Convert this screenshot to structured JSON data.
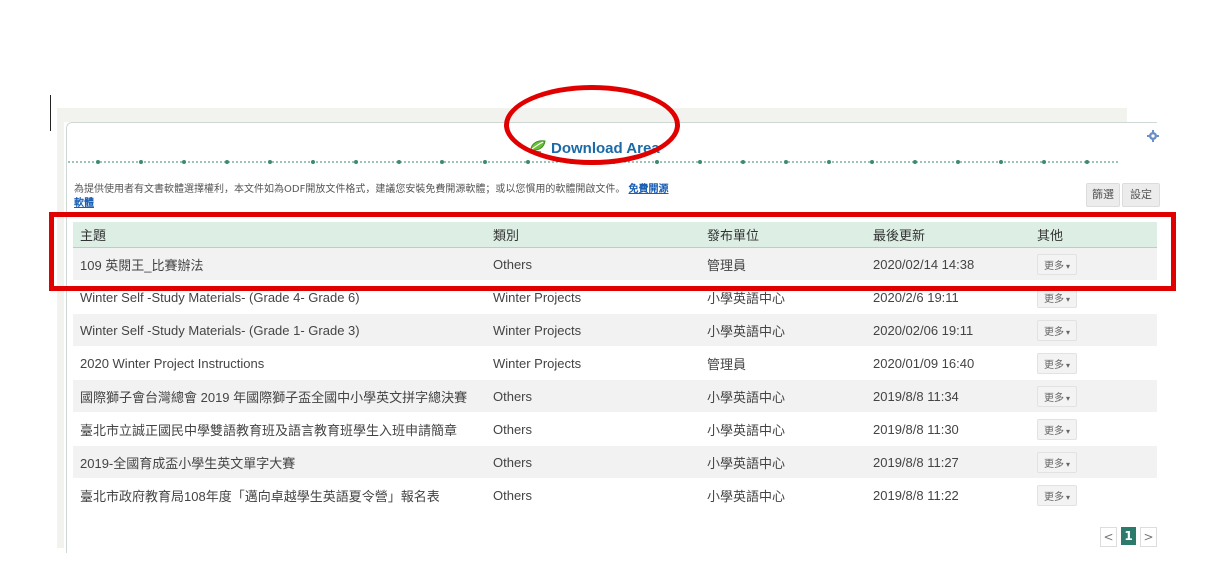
{
  "panel": {
    "title": "Download Area",
    "notice_text": "為提供使用者有文書軟體選擇權利，本文件如為ODF開放文件格式，建議您安裝免費開源軟體；或以您慣用的軟體開啟文件。",
    "notice_link": "免費開源軟體",
    "filter_label": "篩選",
    "settings_label": "設定"
  },
  "table": {
    "headers": [
      "主題",
      "類別",
      "發布單位",
      "最後更新",
      "其他"
    ],
    "more_label": "更多",
    "rows": [
      {
        "subject": "109 英閱王_比賽辦法",
        "category": "Others",
        "publisher": "管理員",
        "updated": "2020/02/14 14:38"
      },
      {
        "subject": "Winter Self -Study Materials- (Grade 4- Grade 6)",
        "category": "Winter Projects",
        "publisher": "小學英語中心",
        "updated": "2020/2/6 19:11"
      },
      {
        "subject": "Winter Self -Study Materials- (Grade 1- Grade 3)",
        "category": "Winter Projects",
        "publisher": "小學英語中心",
        "updated": "2020/02/06 19:11"
      },
      {
        "subject": "2020 Winter Project Instructions",
        "category": "Winter Projects",
        "publisher": "管理員",
        "updated": "2020/01/09 16:40"
      },
      {
        "subject": "國際獅子會台灣總會 2019 年國際獅子盃全國中小學英文拼字總決賽",
        "category": "Others",
        "publisher": "小學英語中心",
        "updated": "2019/8/8 11:34"
      },
      {
        "subject": "臺北市立誠正國民中學雙語教育班及語言教育班學生入班申請簡章",
        "category": "Others",
        "publisher": "小學英語中心",
        "updated": "2019/8/8 11:30"
      },
      {
        "subject": "2019-全國育成盃小學生英文單字大賽",
        "category": "Others",
        "publisher": "小學英語中心",
        "updated": "2019/8/8 11:27"
      },
      {
        "subject": "臺北市政府教育局108年度「邁向卓越學生英語夏令營」報名表",
        "category": "Others",
        "publisher": "小學英語中心",
        "updated": "2019/8/8 11:22"
      }
    ]
  },
  "pagination": {
    "prev": "<",
    "current": "1",
    "next": ">"
  },
  "icons": {
    "leaf": "leaf-icon",
    "gear": "gear-icon",
    "caret": "caret-down-icon"
  },
  "colors": {
    "title": "#1a6aa8",
    "header_bg": "#ddeee5",
    "highlight": "#e00000",
    "page_active": "#2b7a6b"
  }
}
